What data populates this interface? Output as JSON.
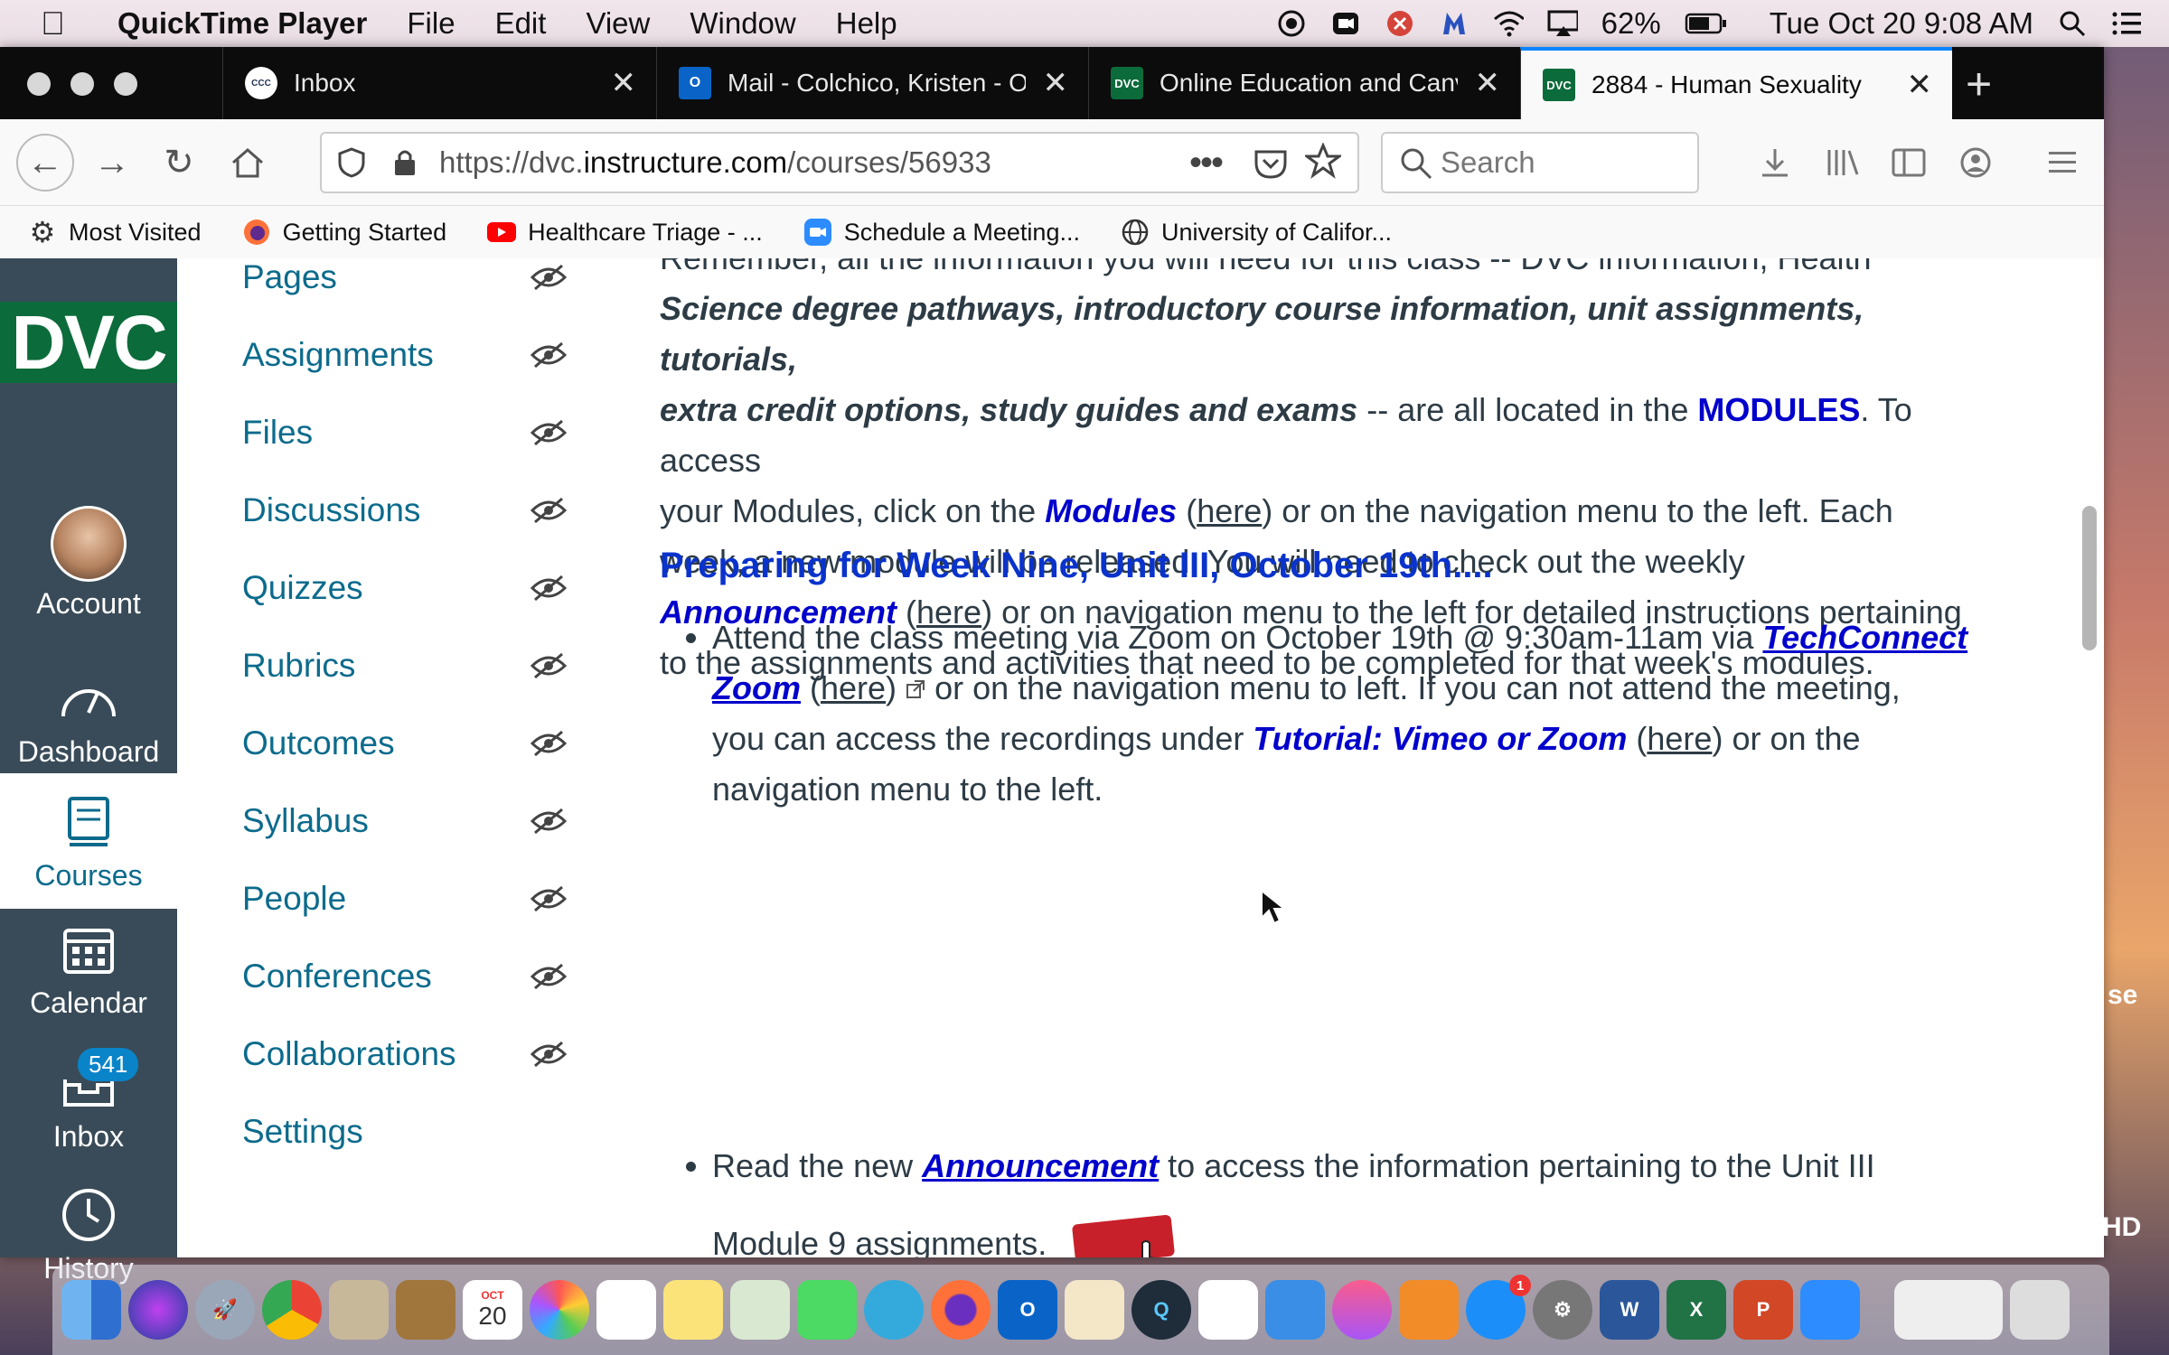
{
  "menubar": {
    "app_name": "QuickTime Player",
    "menus": [
      "File",
      "Edit",
      "View",
      "Window",
      "Help"
    ],
    "battery": "62%",
    "clock": "Tue Oct 20  9:08 AM"
  },
  "tabs": [
    {
      "title": "Inbox",
      "favicon": "cccco-icon"
    },
    {
      "title": "Mail - Colchico, Kristen - O",
      "favicon": "outlook-icon"
    },
    {
      "title": "Online Education and Canva",
      "favicon": "dvc-icon"
    },
    {
      "title": "2884 - Human Sexuality",
      "favicon": "dvc-icon"
    }
  ],
  "navbar": {
    "url_prefix": "https://dvc.",
    "url_domain": "instructure.com",
    "url_path": "/courses/56933",
    "search_placeholder": "Search"
  },
  "bookmarks": [
    "Most Visited",
    "Getting Started",
    "Healthcare Triage - ...",
    "Schedule a Meeting...",
    "University of Califor..."
  ],
  "global_nav": {
    "logo": "DVC",
    "items": [
      "Account",
      "Dashboard",
      "Courses",
      "Calendar",
      "Inbox",
      "History"
    ],
    "inbox_count": "541"
  },
  "course_nav": [
    "Pages",
    "Assignments",
    "Files",
    "Discussions",
    "Quizzes",
    "Rubrics",
    "Outcomes",
    "Syllabus",
    "People",
    "Conferences",
    "Collaborations",
    "Settings"
  ],
  "content": {
    "para_top_cut": "Remember, all the information you will need for this class -- DVC information, Health",
    "p1_bold": "Science degree pathways, introductory course information, unit assignments, tutorials,",
    "p2_bold": "extra credit options, study guides and exams",
    "p2_rest": " -- are all located in the ",
    "modules_caps": "MODULES",
    "p2_tail": ". To access",
    "p3_a": "your Modules, click on the ",
    "modules_link": "Modules",
    "here": "here",
    "p3_b": " or on the navigation menu to the left. Each",
    "p4": "week, a new module will be released. You will need to check out the weekly",
    "announcement_link": "Announcement",
    "p5_b": " or on navigation menu to the left for detailed instructions pertaining",
    "p6": "to the assignments and activities that need to be completed for that week's modules.",
    "heading": "Preparing for Week Nine, Unit III, October 19th....",
    "b1_a": "Attend the class meeting via Zoom on  October 19th @ 9:30am-11am via ",
    "techconnect": "TechConnect",
    "zoom": "Zoom",
    "b1_b": " or on the navigation menu to left. If you can not attend the meeting,",
    "b1_c": "you can access the recordings under ",
    "tutorial_link": "Tutorial: Vimeo or Zoom",
    "b1_d": " or on the",
    "b1_e": "navigation menu to the left.",
    "b2_a": "Read the new ",
    "b2_b": " to access the information pertaining to the Unit III",
    "b2_c": "Module 9 assignments.",
    "click_here": "CLICK HERE"
  },
  "dock": {
    "calendar_month": "OCT",
    "calendar_day": "20",
    "appstore_badge": "1"
  },
  "desktop_edge": {
    "se": "se",
    "hd": "HD"
  }
}
